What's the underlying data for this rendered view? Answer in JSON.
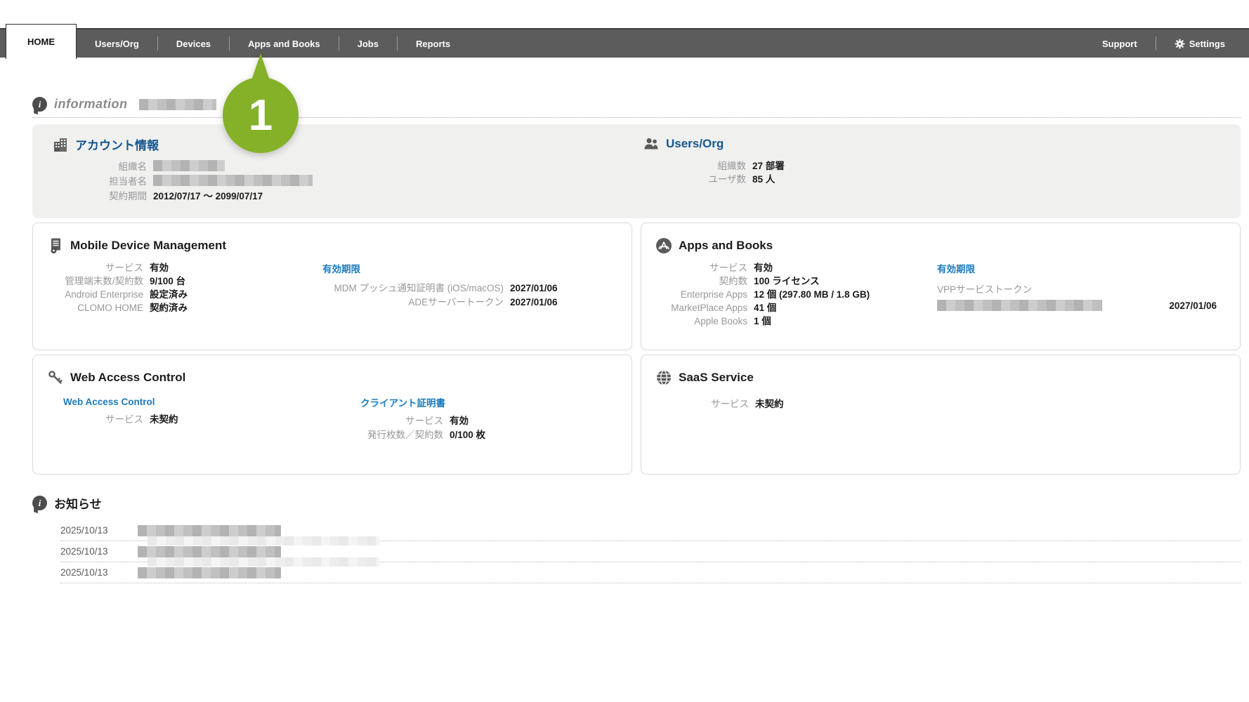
{
  "nav": {
    "tabs": [
      {
        "label": "HOME",
        "active": true
      },
      {
        "label": "Users/Org"
      },
      {
        "label": "Devices"
      },
      {
        "label": "Apps and Books"
      },
      {
        "label": "Jobs"
      },
      {
        "label": "Reports"
      }
    ],
    "support": "Support",
    "settings": "Settings"
  },
  "callout": {
    "number": "1",
    "color": "#85b129"
  },
  "information": {
    "title": "information"
  },
  "account": {
    "title": "アカウント情報",
    "rows": [
      {
        "label": "組織名",
        "redacted": true
      },
      {
        "label": "担当者名",
        "redacted": true
      },
      {
        "label": "契約期間",
        "value": "2012/07/17 ～ 2099/07/17"
      }
    ]
  },
  "users_org": {
    "title": "Users/Org",
    "rows": [
      {
        "label": "組織数",
        "value": "27 部署"
      },
      {
        "label": "ユーザ数",
        "value": "85 人"
      }
    ]
  },
  "mdm": {
    "title": "Mobile Device Management",
    "left_rows": [
      {
        "label": "サービス",
        "value": "有効"
      },
      {
        "label": "管理端末数/契約数",
        "value": "9/100 台"
      },
      {
        "label": "Android Enterprise",
        "value": "設定済み"
      },
      {
        "label": "CLOMO HOME",
        "value": "契約済み"
      }
    ],
    "expiry_link": "有効期限",
    "right_rows": [
      {
        "label": "MDM プッシュ通知証明書 (iOS/macOS)",
        "value": "2027/01/06"
      },
      {
        "label": "ADEサーバートークン",
        "value": "2027/01/06"
      }
    ]
  },
  "apps_books": {
    "title": "Apps and Books",
    "left_rows": [
      {
        "label": "サービス",
        "value": "有効"
      },
      {
        "label": "契約数",
        "value": "100 ライセンス"
      },
      {
        "label": "Enterprise Apps",
        "value": "12 個 (297.80 MB / 1.8 GB)"
      },
      {
        "label": "MarketPlace Apps",
        "value": "41 個"
      },
      {
        "label": "Apple Books",
        "value": "1 個"
      }
    ],
    "expiry_link": "有効期限",
    "vpp_token_label": "VPPサービストークン",
    "vpp_token_date": "2027/01/06"
  },
  "web_access": {
    "title": "Web Access Control",
    "left_link": "Web Access Control",
    "left_rows": [
      {
        "label": "サービス",
        "value": "未契約"
      }
    ],
    "right_link": "クライアント証明書",
    "right_rows": [
      {
        "label": "サービス",
        "value": "有効"
      },
      {
        "label": "発行枚数／契約数",
        "value": "0/100 枚"
      }
    ]
  },
  "saas": {
    "title": "SaaS Service",
    "rows": [
      {
        "label": "サービス",
        "value": "未契約"
      }
    ]
  },
  "news": {
    "title": "お知らせ",
    "items": [
      {
        "date": "2025/10/13",
        "redacted": true
      },
      {
        "date": "2025/10/13",
        "redacted": true
      },
      {
        "date": "2025/10/13",
        "redacted": true
      }
    ]
  }
}
